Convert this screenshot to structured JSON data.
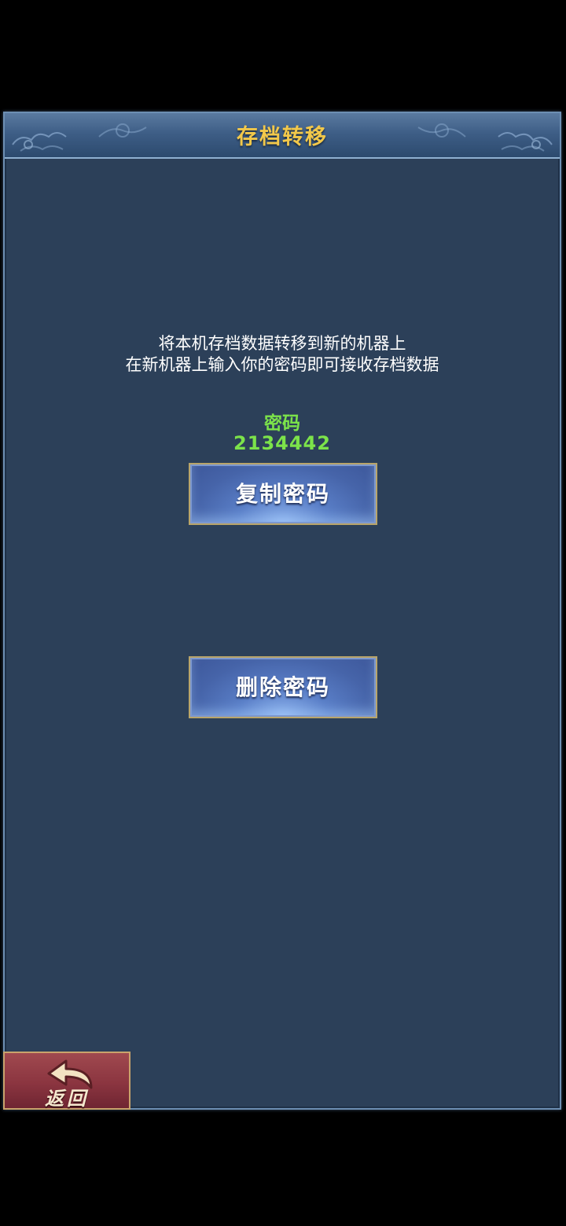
{
  "header": {
    "title": "存档转移"
  },
  "description": {
    "line1": "将本机存档数据转移到新的机器上",
    "line2": "在新机器上输入你的密码即可接收存档数据"
  },
  "password": {
    "label": "密码",
    "value": "2134442"
  },
  "buttons": {
    "copy_label": "复制密码",
    "delete_label": "删除密码"
  },
  "footer": {
    "back_label": "返回"
  },
  "colors": {
    "panel_bg": "#2c4059",
    "title_text": "#f2c84a",
    "password_text": "#7ce34a",
    "button_bg": "#4664a9",
    "back_button_bg": "#8b3540"
  }
}
